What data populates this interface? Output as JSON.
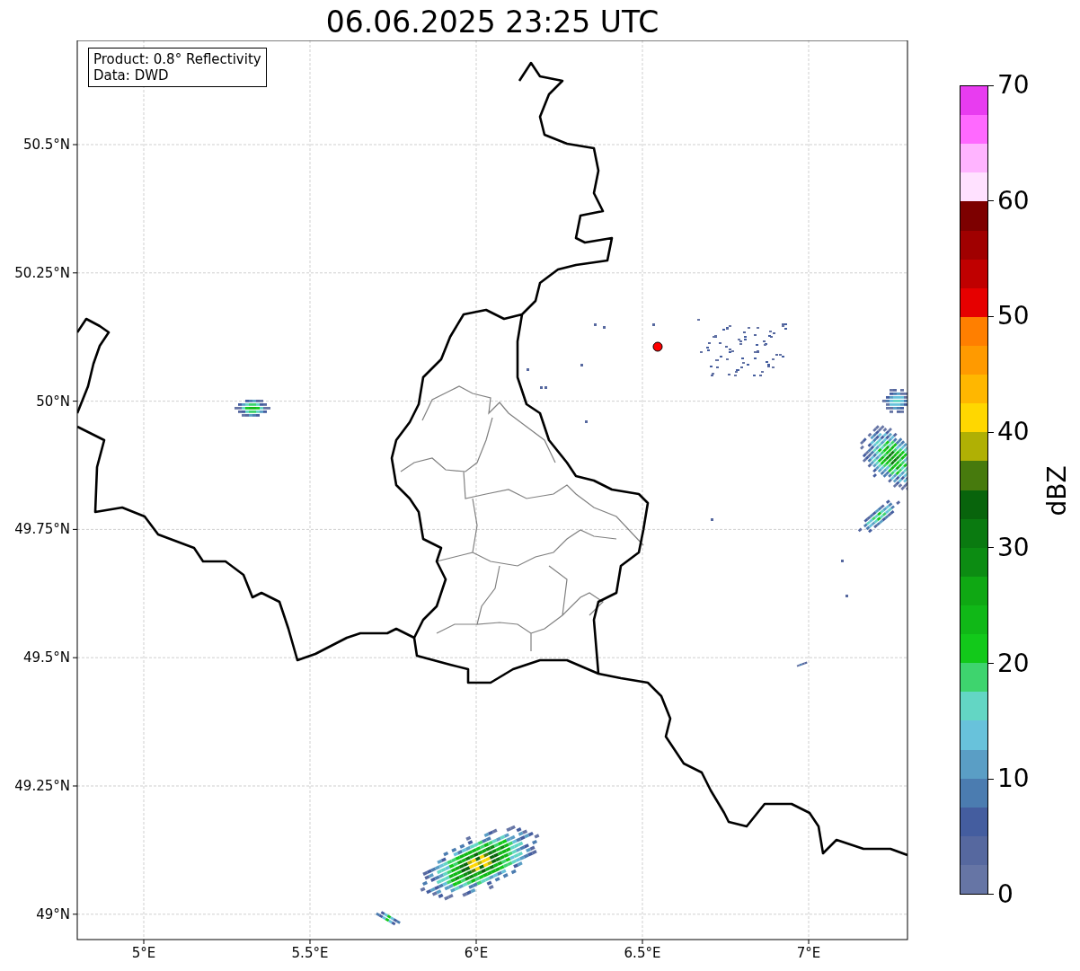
{
  "title": "06.06.2025 23:25 UTC",
  "info_box": {
    "lines": [
      "Product: 0.8° Reflectivity",
      "Data: DWD"
    ]
  },
  "map": {
    "x_ticks": [
      "5°E",
      "5.5°E",
      "6°E",
      "6.5°E",
      "7°E"
    ],
    "y_ticks": [
      "50.5°N",
      "50.25°N",
      "50°N",
      "49.75°N",
      "49.5°N",
      "49.25°N",
      "49°N"
    ]
  },
  "colorbar": {
    "label": "dBZ",
    "ticks": [
      "70",
      "60",
      "50",
      "40",
      "30",
      "20",
      "10",
      "0"
    ],
    "segments": [
      {
        "color": "#e83cf0"
      },
      {
        "color": "#ff69ff"
      },
      {
        "color": "#ffb4ff"
      },
      {
        "color": "#ffe1ff"
      },
      {
        "color": "#7d0000"
      },
      {
        "color": "#a00000"
      },
      {
        "color": "#c00000"
      },
      {
        "color": "#e60000"
      },
      {
        "color": "#ff7f00"
      },
      {
        "color": "#ff9a00"
      },
      {
        "color": "#ffb700"
      },
      {
        "color": "#ffd700"
      },
      {
        "color": "#b0b004"
      },
      {
        "color": "#477a0d"
      },
      {
        "color": "#08640c"
      },
      {
        "color": "#0a7a10"
      },
      {
        "color": "#0c8c12"
      },
      {
        "color": "#0fa813"
      },
      {
        "color": "#10b817"
      },
      {
        "color": "#12c91a"
      },
      {
        "color": "#3ed46e"
      },
      {
        "color": "#63d6c4"
      },
      {
        "color": "#68c2db"
      },
      {
        "color": "#5a9ec5"
      },
      {
        "color": "#4b7cb0"
      },
      {
        "color": "#445d9f"
      },
      {
        "color": "#56689f"
      },
      {
        "color": "#6675a5"
      }
    ]
  }
}
